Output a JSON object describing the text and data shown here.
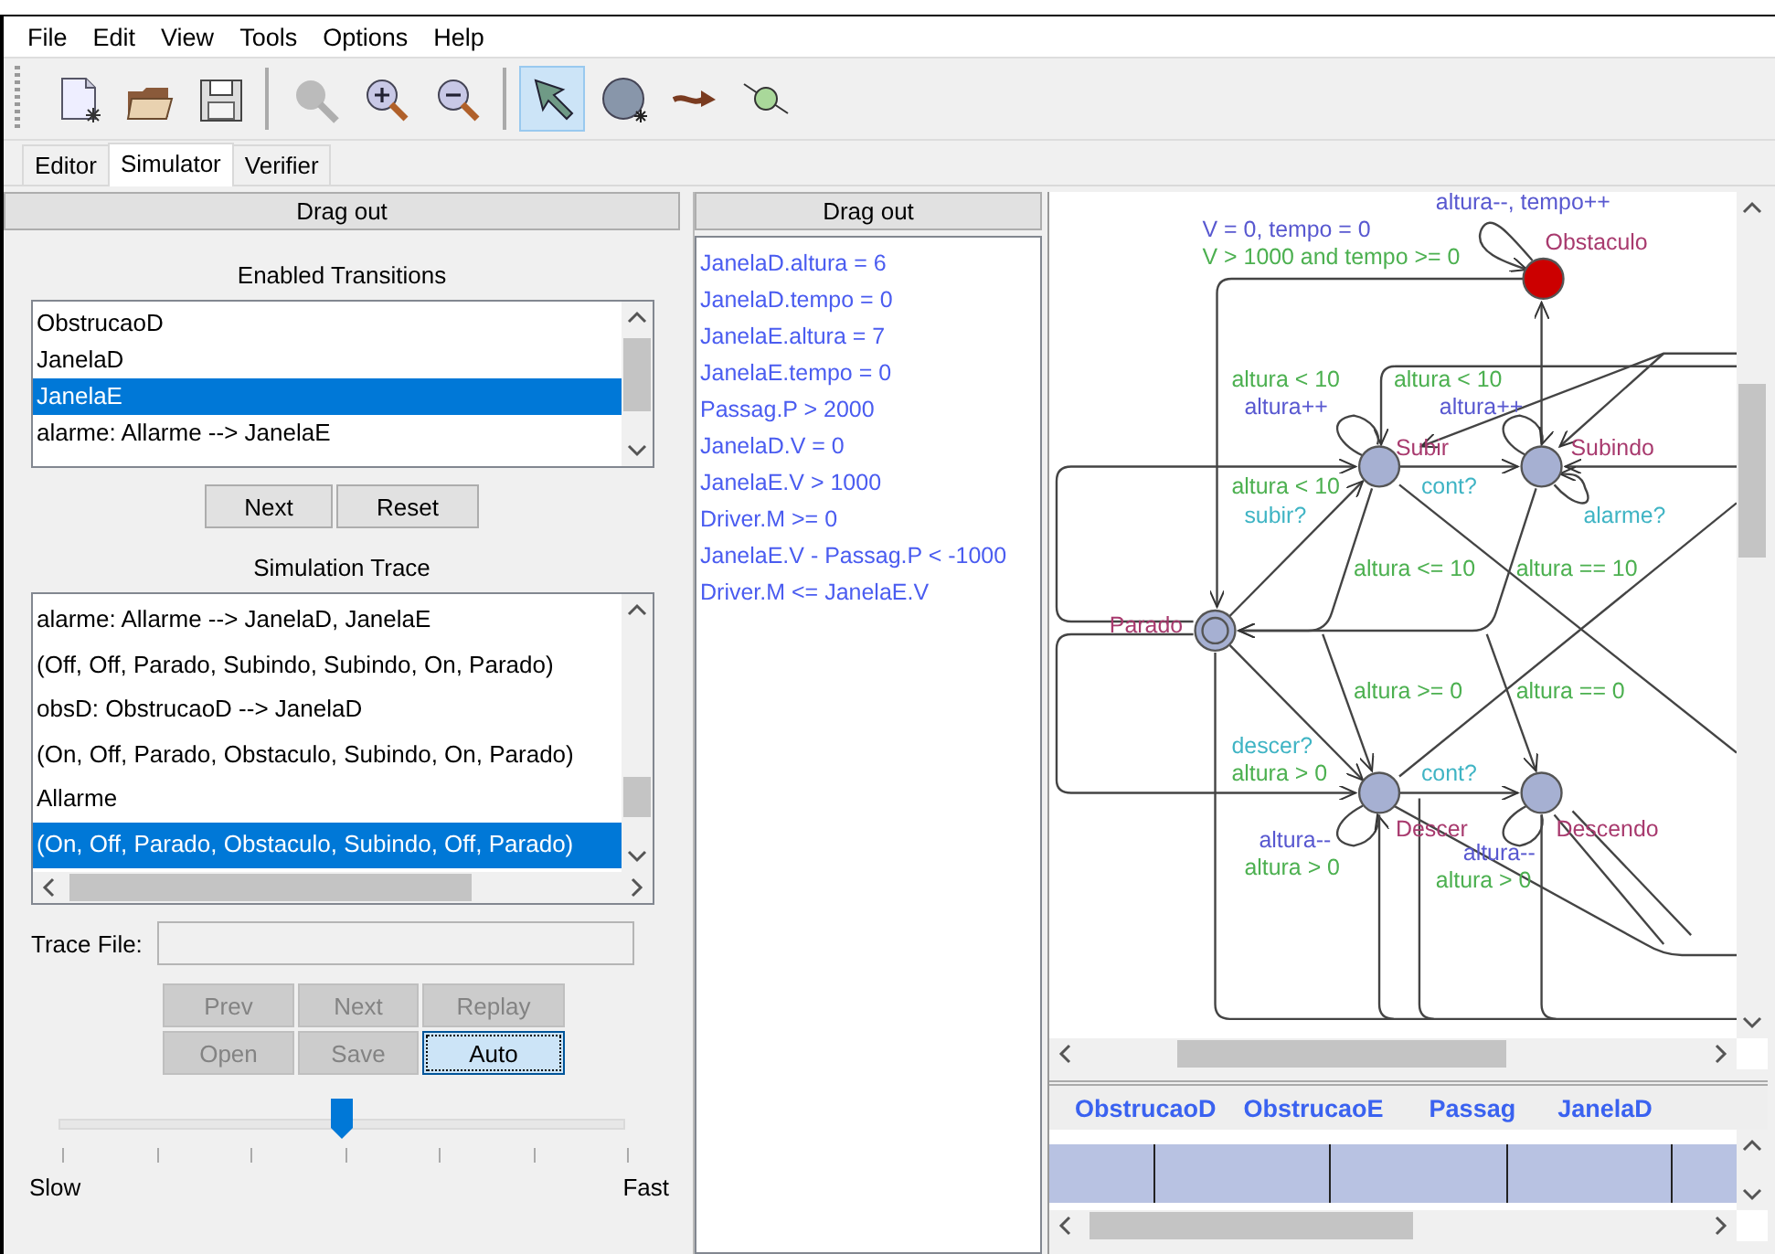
{
  "menu": [
    "File",
    "Edit",
    "View",
    "Tools",
    "Options",
    "Help"
  ],
  "toolbar": [
    {
      "kind": "new",
      "selected": false,
      "disabled": false
    },
    {
      "kind": "open",
      "selected": false,
      "disabled": false
    },
    {
      "kind": "save",
      "selected": false,
      "disabled": false
    },
    {
      "kind": "separator"
    },
    {
      "kind": "zoom",
      "selected": false,
      "disabled": true
    },
    {
      "kind": "zoom-in",
      "selected": false,
      "disabled": false
    },
    {
      "kind": "zoom-out",
      "selected": false,
      "disabled": false
    },
    {
      "kind": "separator"
    },
    {
      "kind": "select",
      "selected": true,
      "disabled": false
    },
    {
      "kind": "location",
      "selected": false,
      "disabled": false
    },
    {
      "kind": "edge",
      "selected": false,
      "disabled": false
    },
    {
      "kind": "nail",
      "selected": false,
      "disabled": false
    }
  ],
  "tabs": [
    {
      "label": "Editor",
      "selected": false
    },
    {
      "label": "Simulator",
      "selected": true
    },
    {
      "label": "Verifier",
      "selected": false
    }
  ],
  "simulator": {
    "drag_out": "Drag out",
    "enabled_transitions": {
      "title": "Enabled Transitions",
      "items": [
        {
          "text": "ObstrucaoD",
          "selected": false
        },
        {
          "text": "JanelaD",
          "selected": false
        },
        {
          "text": "JanelaE",
          "selected": true
        },
        {
          "text": "alarme: Allarme --> JanelaE",
          "selected": false
        }
      ]
    },
    "transition_buttons": [
      {
        "label": "Next",
        "disabled": false
      },
      {
        "label": "Reset",
        "disabled": false
      }
    ],
    "simulation_trace": {
      "title": "Simulation Trace",
      "items": [
        {
          "text": "alarme: Allarme --> JanelaD, JanelaE",
          "selected": false
        },
        {
          "text": "(Off, Off, Parado, Subindo, Subindo, On, Parado)",
          "selected": false
        },
        {
          "text": "obsD: ObstrucaoD --> JanelaD",
          "selected": false
        },
        {
          "text": "(On, Off, Parado, Obstaculo, Subindo, On, Parado)",
          "selected": false
        },
        {
          "text": "Allarme",
          "selected": false
        },
        {
          "text": "(On, Off, Parado, Obstaculo, Subindo, Off, Parado)",
          "selected": true
        }
      ]
    },
    "trace_file": {
      "label": "Trace File:"
    },
    "trace_buttons": [
      {
        "label": "Prev",
        "disabled": true,
        "focused": false
      },
      {
        "label": "Next",
        "disabled": true,
        "focused": false
      },
      {
        "label": "Replay",
        "disabled": true,
        "focused": false
      },
      {
        "label": "Open",
        "disabled": true,
        "focused": false
      },
      {
        "label": "Save",
        "disabled": true,
        "focused": false
      },
      {
        "label": "Auto",
        "disabled": false,
        "focused": true
      }
    ],
    "speed": {
      "level": 0.5,
      "min_label": "Slow",
      "max_label": "Fast"
    }
  },
  "variables": {
    "drag_out": "Drag out",
    "constraints": [
      "JanelaD.altura = 6",
      "JanelaD.tempo = 0",
      "JanelaE.altura = 7",
      "JanelaE.tempo = 0",
      "Passag.P > 2000",
      "JanelaD.V = 0",
      "JanelaE.V > 1000",
      "Driver.M >= 0",
      "JanelaE.V - Passag.P < -1000",
      "Driver.M <= JanelaE.V"
    ]
  },
  "diagram": {
    "locations": [
      {
        "name": "Obstaculo",
        "current": true,
        "initial": false
      },
      {
        "name": "Subir",
        "current": false,
        "initial": false
      },
      {
        "name": "Subindo",
        "current": false,
        "initial": false
      },
      {
        "name": "Parado",
        "current": false,
        "initial": true
      },
      {
        "name": "Descer",
        "current": false,
        "initial": false
      },
      {
        "name": "Descendo",
        "current": false,
        "initial": false
      }
    ],
    "labels": [
      {
        "text": "altura--, tempo++",
        "kind": "update"
      },
      {
        "text": "V = 0, tempo = 0",
        "kind": "update"
      },
      {
        "text": "V > 1000 and tempo >= 0",
        "kind": "guard"
      },
      {
        "text": "altura < 10",
        "kind": "guard"
      },
      {
        "text": "altura++",
        "kind": "update"
      },
      {
        "text": "altura < 10",
        "kind": "guard"
      },
      {
        "text": "altura++",
        "kind": "update"
      },
      {
        "text": "altura < 10",
        "kind": "guard"
      },
      {
        "text": "subir?",
        "kind": "sync"
      },
      {
        "text": "cont?",
        "kind": "sync"
      },
      {
        "text": "alarme?",
        "kind": "sync"
      },
      {
        "text": "altura <= 10",
        "kind": "guard"
      },
      {
        "text": "altura == 10",
        "kind": "guard"
      },
      {
        "text": "altura >= 0",
        "kind": "guard"
      },
      {
        "text": "altura == 0",
        "kind": "guard"
      },
      {
        "text": "descer?",
        "kind": "sync"
      },
      {
        "text": "altura > 0",
        "kind": "guard"
      },
      {
        "text": "cont?",
        "kind": "sync"
      },
      {
        "text": "altura--",
        "kind": "update"
      },
      {
        "text": "altura > 0",
        "kind": "guard"
      },
      {
        "text": "altura--",
        "kind": "update"
      },
      {
        "text": "altura > 0",
        "kind": "guard"
      }
    ]
  },
  "trace_table": {
    "columns": [
      "ObstrucaoD",
      "ObstrucaoE",
      "Passag",
      "JanelaD"
    ]
  }
}
